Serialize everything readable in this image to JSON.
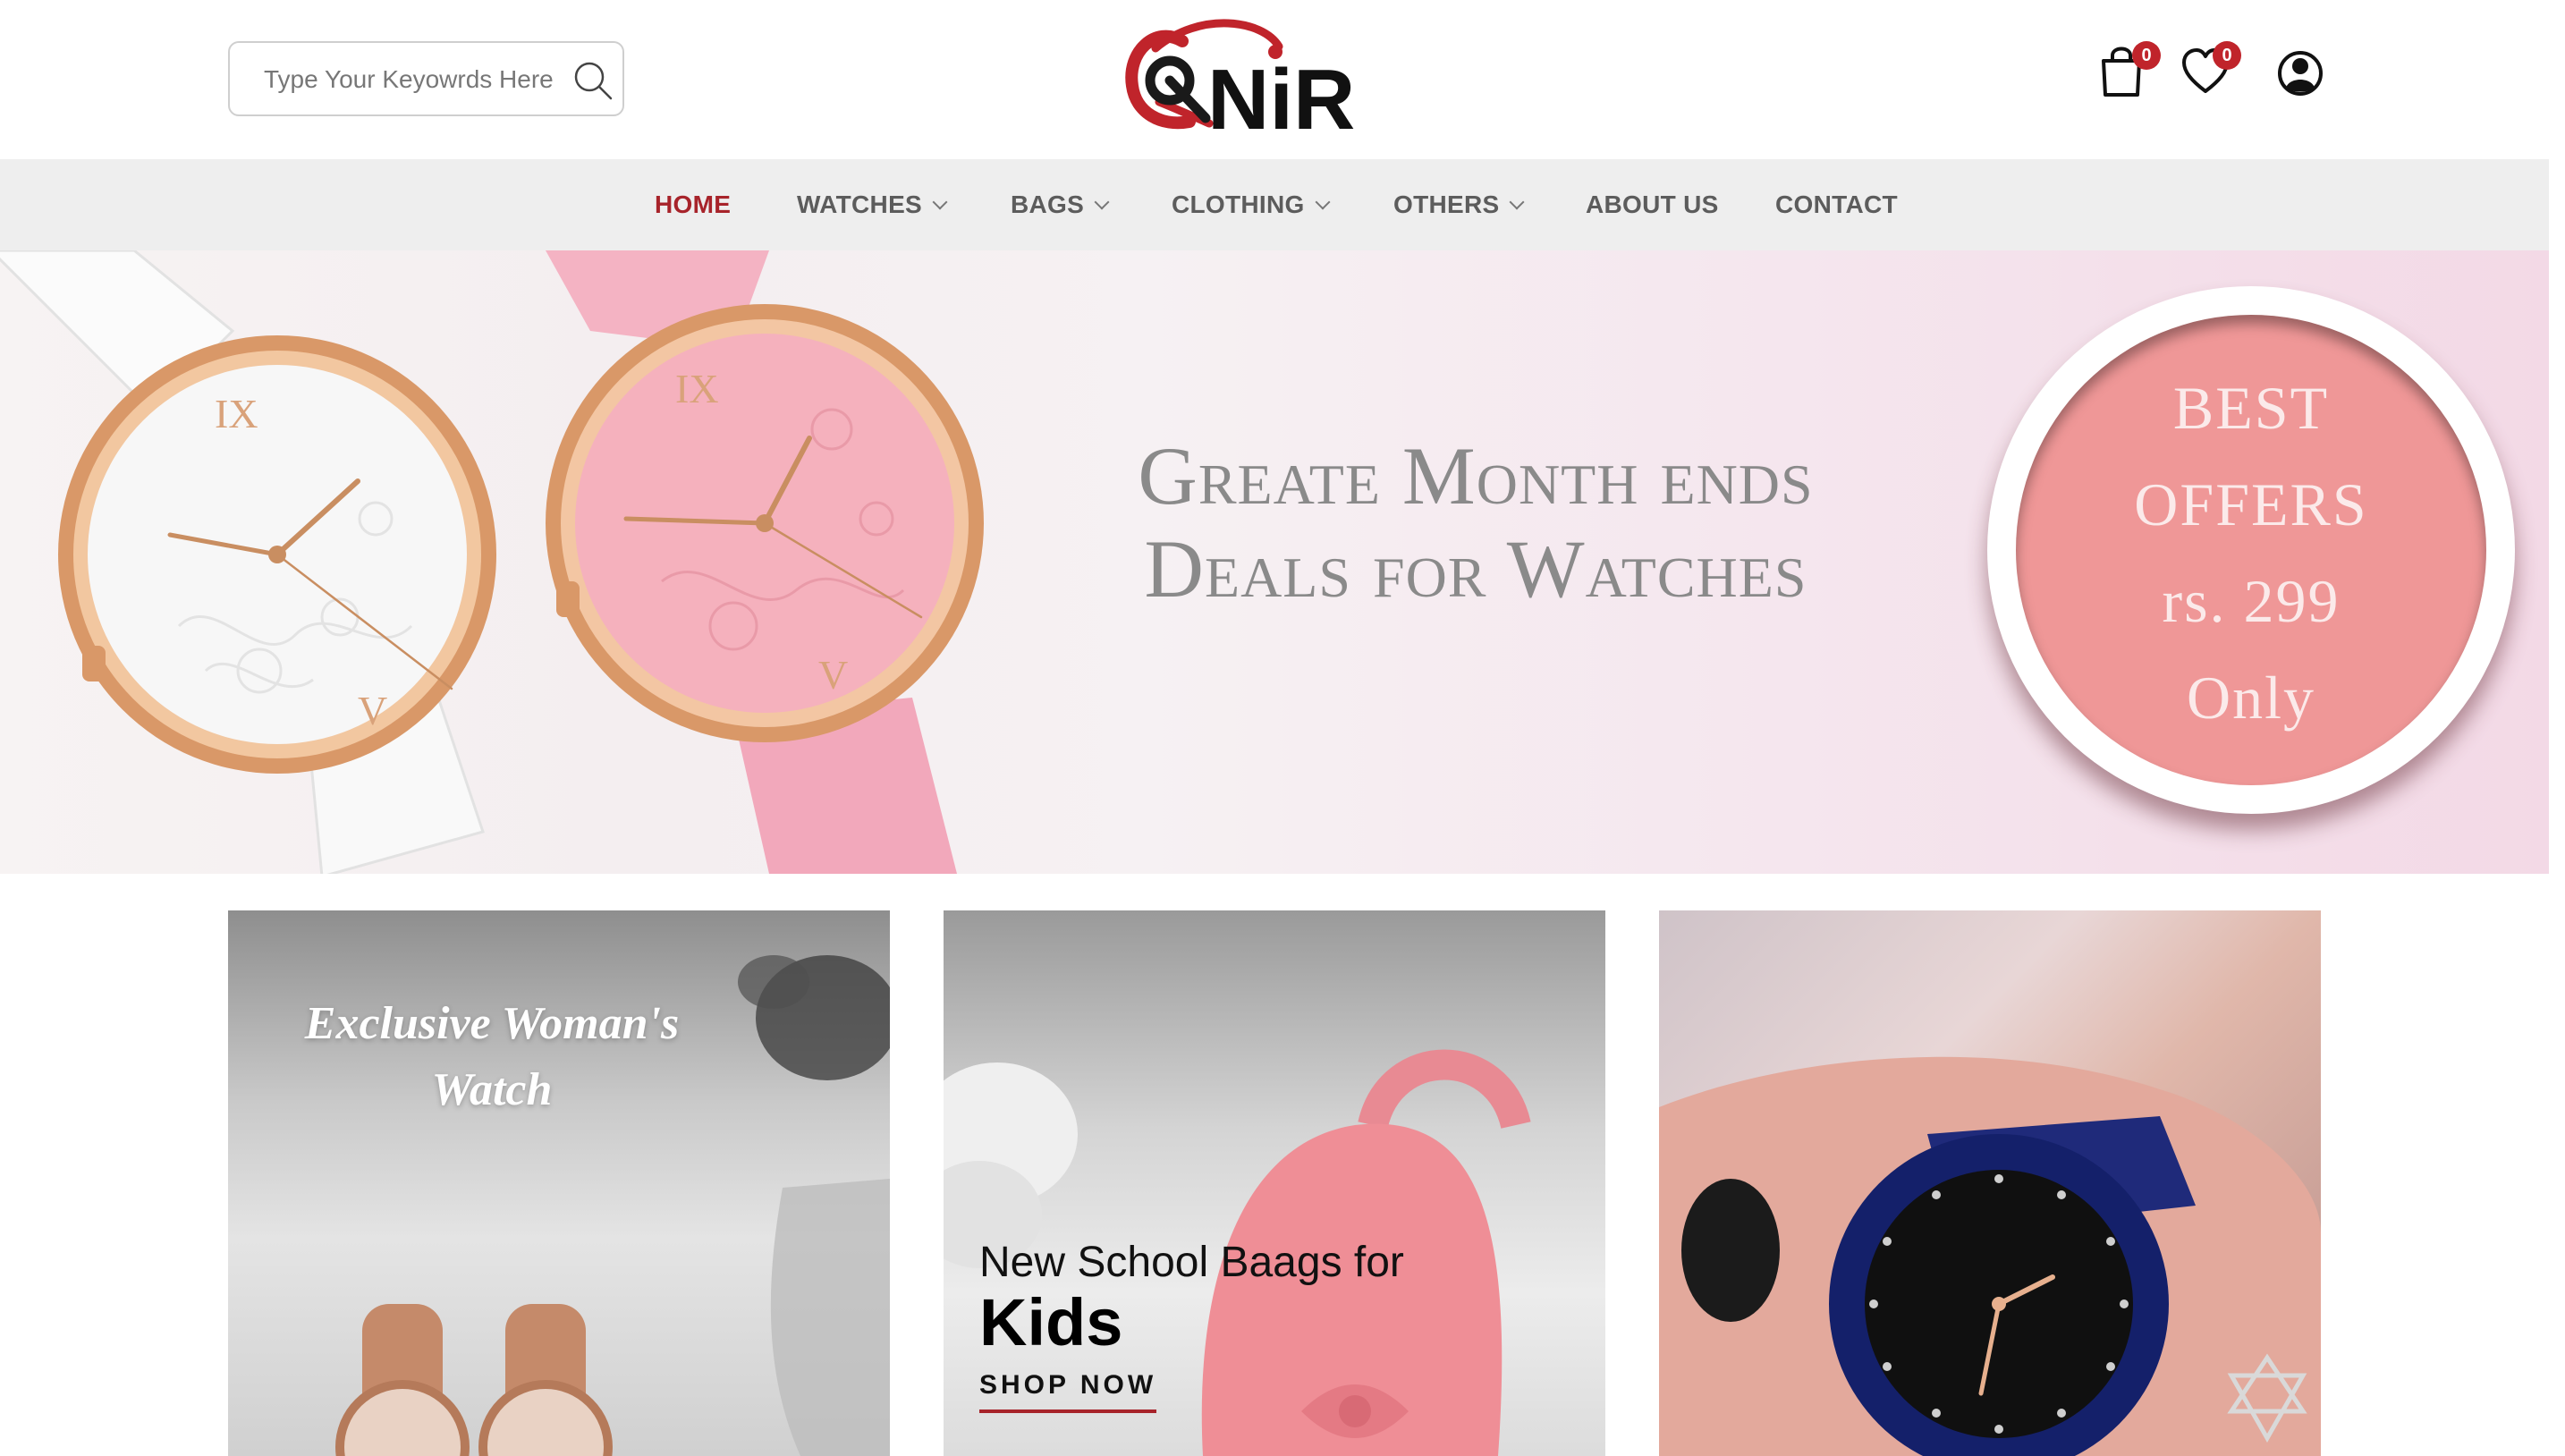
{
  "header": {
    "search": {
      "placeholder": "Type Your Keyowrds Here"
    },
    "logo_text": "NiR",
    "cart": {
      "count": "0"
    },
    "wishlist": {
      "count": "0"
    }
  },
  "nav": {
    "items": [
      {
        "label": "HOME",
        "active": true
      },
      {
        "label": "WATCHES",
        "dropdown": true
      },
      {
        "label": "BAGS",
        "dropdown": true
      },
      {
        "label": "CLOTHING",
        "dropdown": true
      },
      {
        "label": "OTHERS",
        "dropdown": true
      },
      {
        "label": "ABOUT US"
      },
      {
        "label": "CONTACT"
      }
    ]
  },
  "hero": {
    "title_line1": "Greate Month ends",
    "title_line2": "Deals for Watches",
    "offer": {
      "line1": "BEST",
      "line2": "OFFERS",
      "line3": "rs. 299",
      "line4": "Only"
    }
  },
  "promos": [
    {
      "title_line1": "Exclusive Woman's",
      "title_line2": "Watch"
    },
    {
      "subtitle": "New School Baags for",
      "title": "Kids",
      "link": "SHOP NOW"
    },
    {}
  ],
  "colors": {
    "accent": "#a7232a",
    "badge": "#c0242b",
    "nav_bg": "#eeeeee",
    "offer_pink": "#ef9797"
  }
}
